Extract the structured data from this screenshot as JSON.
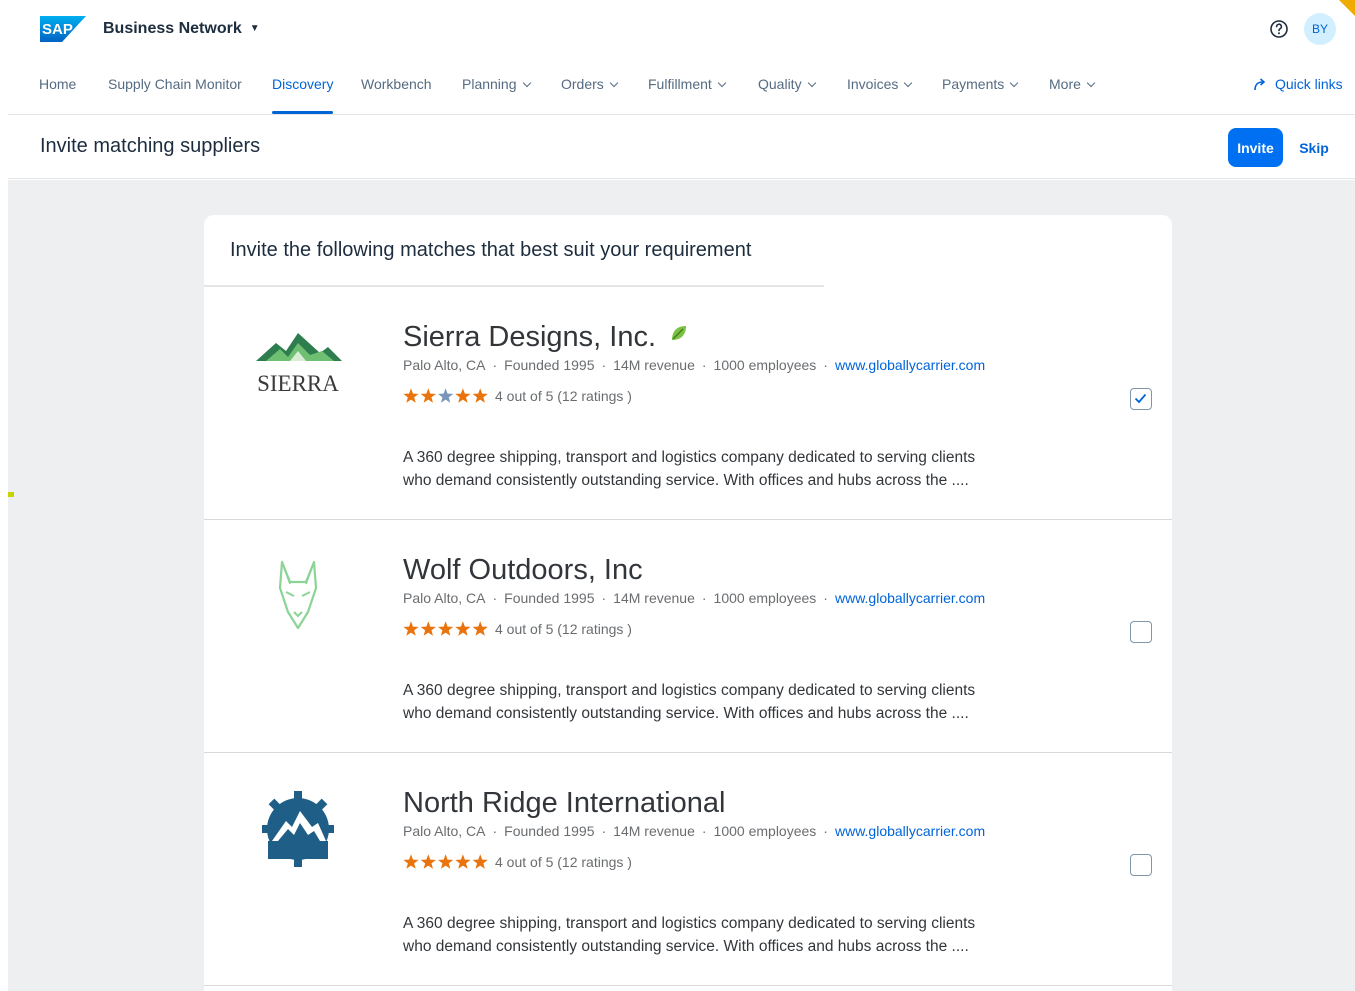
{
  "shell": {
    "logo_text": "SAP",
    "product": "Business Network",
    "avatar": "BY",
    "help_icon": "help-circle-icon"
  },
  "nav": {
    "items": [
      {
        "label": "Home",
        "dropdown": false
      },
      {
        "label": "Supply Chain Monitor",
        "dropdown": false
      },
      {
        "label": "Discovery",
        "dropdown": false,
        "active": true
      },
      {
        "label": "Workbench",
        "dropdown": false
      },
      {
        "label": "Planning",
        "dropdown": true
      },
      {
        "label": "Orders",
        "dropdown": true
      },
      {
        "label": "Fulfillment",
        "dropdown": true
      },
      {
        "label": "Quality",
        "dropdown": true
      },
      {
        "label": "Invoices",
        "dropdown": true
      },
      {
        "label": "Payments",
        "dropdown": true
      },
      {
        "label": "More",
        "dropdown": true
      }
    ],
    "quick_links": "Quick links"
  },
  "page": {
    "title": "Invite matching suppliers",
    "invite_label": "Invite",
    "skip_label": "Skip"
  },
  "card": {
    "header": "Invite the following matches that best suit your requirement"
  },
  "suppliers": [
    {
      "name": "Sierra Designs, Inc.",
      "logo_text": "SIERRA",
      "location": "Palo Alto, CA",
      "founded": "Founded 1995",
      "revenue": "14M revenue",
      "employees": "1000 employees",
      "website": "www.globallycarrier.com",
      "rating_text": "4 out of 5 (12 ratings )",
      "rating": 4,
      "description": "A 360 degree shipping, transport and logistics company dedicated to serving clients who demand consistently outstanding service. With offices and hubs across the ....",
      "selected": true
    },
    {
      "name": "Wolf Outdoors, Inc",
      "location": "Palo Alto, CA",
      "founded": "Founded 1995",
      "revenue": "14M revenue",
      "employees": "1000 employees",
      "website": "www.globallycarrier.com",
      "rating_text": "4 out of 5 (12 ratings )",
      "rating": 5,
      "description": "A 360 degree shipping, transport and logistics company dedicated to serving clients who demand consistently outstanding service. With offices and hubs across the ....",
      "selected": false
    },
    {
      "name": "North Ridge International",
      "location": "Palo Alto, CA",
      "founded": "Founded 1995",
      "revenue": "14M revenue",
      "employees": "1000 employees",
      "website": "www.globallycarrier.com",
      "rating_text": "4 out of 5 (12 ratings )",
      "rating": 5,
      "description": "A 360 degree shipping, transport and logistics company dedicated to serving clients who demand consistently outstanding service. With offices and hubs across the ....",
      "selected": false
    }
  ],
  "colors": {
    "accent": "#0070f2",
    "link": "#0064d9",
    "star": "#e9730c",
    "star_empty": "#7996b8"
  }
}
